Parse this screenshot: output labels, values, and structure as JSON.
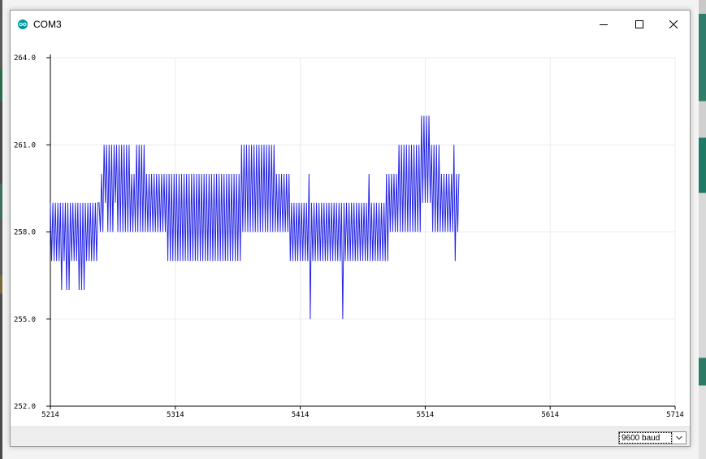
{
  "window": {
    "title": "COM3",
    "icon": "arduino-logo-icon",
    "controls": {
      "minimize_icon": "minimize-icon",
      "maximize_icon": "maximize-icon",
      "close_icon": "close-icon"
    }
  },
  "statusbar": {
    "baud_selected": "9600 baud",
    "dropdown_icon": "chevron-down-icon"
  },
  "colors": {
    "series": "#2626e6",
    "grid": "#ebebeb",
    "axis": "#000000",
    "arduino_teal": "#00979c"
  },
  "chart_data": {
    "type": "line",
    "title": "",
    "xlabel": "",
    "ylabel": "",
    "xlim": [
      5214,
      5714
    ],
    "ylim": [
      252.0,
      264.0
    ],
    "x_ticks": [
      "5214",
      "5314",
      "5414",
      "5514",
      "5614",
      "5714"
    ],
    "y_ticks": [
      "252.0",
      "255.0",
      "258.0",
      "261.0",
      "264.0"
    ],
    "grid": true,
    "series": [
      {
        "x_start": 5214,
        "x_step": 1,
        "values": [
          259,
          257,
          259,
          257,
          259,
          257,
          259,
          257,
          259,
          256,
          259,
          257,
          259,
          256,
          259,
          256,
          259,
          257,
          259,
          257,
          259,
          257,
          259,
          256,
          259,
          256,
          259,
          256,
          259,
          257,
          259,
          257,
          259,
          257,
          259,
          257,
          259,
          257,
          259,
          259,
          258,
          260,
          258,
          261,
          259,
          261,
          258,
          261,
          258,
          261,
          258,
          261,
          259,
          261,
          258,
          261,
          258,
          261,
          258,
          261,
          258,
          261,
          258,
          261,
          258,
          260,
          258,
          260,
          258,
          261,
          258,
          261,
          258,
          261,
          258,
          261,
          258,
          260,
          258,
          260,
          258,
          260,
          258,
          260,
          258,
          260,
          258,
          260,
          258,
          260,
          258,
          260,
          258,
          260,
          257,
          260,
          257,
          260,
          257,
          260,
          257,
          260,
          257,
          260,
          257,
          260,
          257,
          260,
          257,
          260,
          257,
          260,
          257,
          260,
          257,
          260,
          257,
          260,
          257,
          260,
          257,
          260,
          257,
          260,
          257,
          260,
          257,
          260,
          257,
          260,
          257,
          260,
          257,
          260,
          257,
          260,
          257,
          260,
          257,
          260,
          257,
          260,
          257,
          260,
          257,
          260,
          257,
          260,
          257,
          260,
          257,
          260,
          257,
          261,
          258,
          261,
          258,
          261,
          258,
          261,
          258,
          261,
          258,
          261,
          258,
          261,
          258,
          261,
          258,
          261,
          258,
          261,
          258,
          261,
          258,
          261,
          258,
          261,
          258,
          261,
          258,
          260,
          258,
          260,
          258,
          260,
          258,
          260,
          258,
          260,
          258,
          260,
          257,
          259,
          257,
          259,
          257,
          259,
          257,
          259,
          257,
          259,
          257,
          259,
          257,
          259,
          257,
          260,
          255,
          259,
          257,
          259,
          257,
          259,
          257,
          259,
          257,
          259,
          257,
          259,
          257,
          259,
          257,
          259,
          257,
          259,
          257,
          259,
          257,
          259,
          257,
          259,
          257,
          259,
          255,
          259,
          257,
          259,
          257,
          259,
          257,
          259,
          257,
          259,
          257,
          259,
          257,
          259,
          257,
          259,
          257,
          259,
          257,
          259,
          257,
          260,
          257,
          259,
          257,
          259,
          257,
          259,
          257,
          259,
          257,
          259,
          257,
          259,
          257,
          260,
          257,
          260,
          258,
          260,
          258,
          260,
          258,
          260,
          258,
          261,
          258,
          261,
          258,
          261,
          258,
          261,
          258,
          261,
          258,
          261,
          258,
          261,
          258,
          261,
          258,
          261,
          258,
          262,
          259,
          262,
          259,
          262,
          259,
          262,
          259,
          261,
          258,
          261,
          258,
          261,
          258,
          261,
          258,
          260,
          258,
          260,
          258,
          260,
          258,
          260,
          258,
          260,
          258,
          261,
          257,
          260,
          258,
          260
        ]
      }
    ]
  }
}
